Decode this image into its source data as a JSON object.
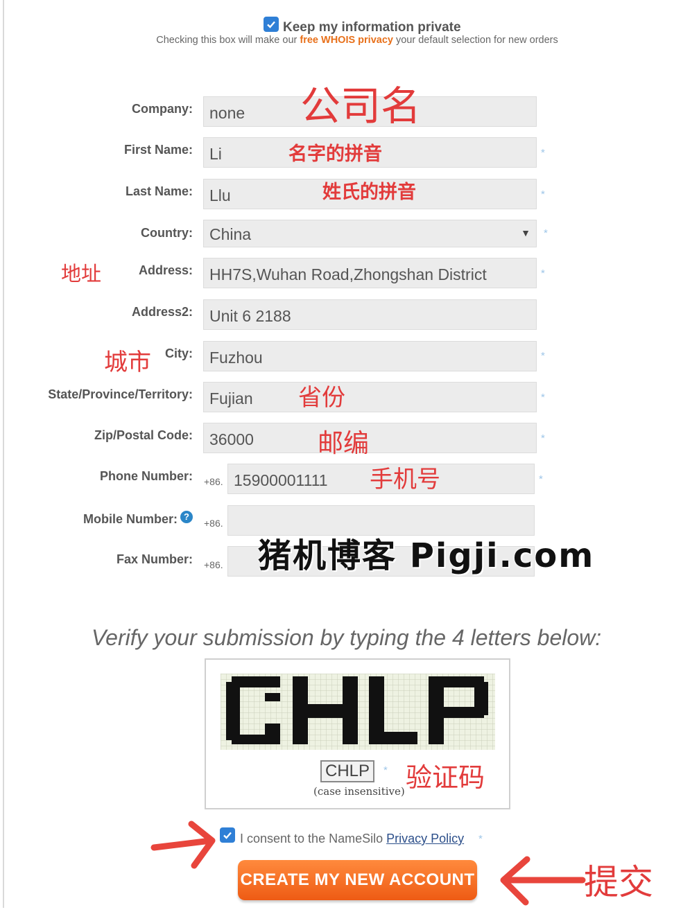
{
  "privacy": {
    "checked": true,
    "title": "Keep my information private",
    "note_before": "Checking this box will make our ",
    "note_highlight": "free WHOIS privacy",
    "note_after": " your default selection for new orders"
  },
  "form": {
    "company": {
      "label": "Company:",
      "value": "none"
    },
    "first_name": {
      "label": "First Name:",
      "value": "Li"
    },
    "last_name": {
      "label": "Last Name:",
      "value": "Llu"
    },
    "country": {
      "label": "Country:",
      "value": "China"
    },
    "address": {
      "label": "Address:",
      "value": "HH7S,Wuhan Road,Zhongshan District"
    },
    "address2": {
      "label": "Address2:",
      "value": "Unit 6 2188"
    },
    "city": {
      "label": "City:",
      "value": "Fuzhou"
    },
    "state": {
      "label": "State/Province/Territory:",
      "value": "Fujian"
    },
    "zip": {
      "label": "Zip/Postal Code:",
      "value": "36000"
    },
    "phone": {
      "label": "Phone Number:",
      "prefix": "+86.",
      "value": "15900001111"
    },
    "mobile": {
      "label": "Mobile Number:",
      "prefix": "+86.",
      "value": ""
    },
    "fax": {
      "label": "Fax Number:",
      "prefix": "+86.",
      "value": ""
    },
    "required_mark": "*",
    "help_mark": "?"
  },
  "annotations": {
    "company": "公司名",
    "first_name": "名字的拼音",
    "last_name": "姓氏的拼音",
    "address": "地址",
    "city": "城市",
    "state": "省份",
    "zip": "邮编",
    "phone": "手机号",
    "captcha": "验证码",
    "submit": "提交"
  },
  "watermark": "猪机博客  Pigji.com",
  "captcha": {
    "instruction": "Verify your submission by typing the 4 letters below:",
    "letters": "CHLP",
    "input_value": "CHLP",
    "note": "(case insensitive)"
  },
  "consent": {
    "checked": true,
    "text": "I consent to the NameSilo ",
    "link": "Privacy Policy"
  },
  "submit_label": "CREATE MY NEW ACCOUNT",
  "colors": {
    "accent_orange": "#ee5b14",
    "annotation_red": "#e23b3b",
    "checkbox_blue": "#2f7fd6"
  }
}
